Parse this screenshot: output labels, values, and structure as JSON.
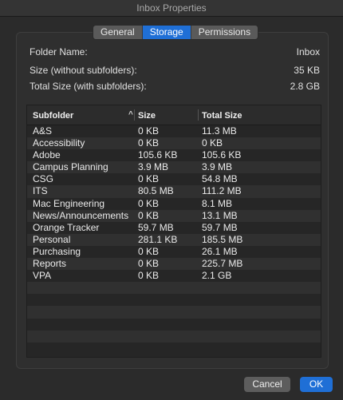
{
  "window": {
    "title": "Inbox Properties"
  },
  "tabs": [
    {
      "label": "General"
    },
    {
      "label": "Storage"
    },
    {
      "label": "Permissions"
    }
  ],
  "info": {
    "folder_name_label": "Folder Name:",
    "folder_name_value": "Inbox",
    "size_label": "Size (without subfolders):",
    "size_value": "35 KB",
    "total_label": "Total Size (with subfolders):",
    "total_value": "2.8 GB"
  },
  "table": {
    "headers": {
      "subfolder": "Subfolder",
      "sort_glyph": "^",
      "size": "Size",
      "total": "Total Size"
    },
    "rows": [
      {
        "name": "A&S",
        "size": "0 KB",
        "total": "11.3 MB"
      },
      {
        "name": "Accessibility",
        "size": "0 KB",
        "total": "0 KB"
      },
      {
        "name": "Adobe",
        "size": "105.6 KB",
        "total": "105.6 KB"
      },
      {
        "name": "Campus Planning",
        "size": "3.9 MB",
        "total": "3.9 MB"
      },
      {
        "name": "CSG",
        "size": "0 KB",
        "total": "54.8 MB"
      },
      {
        "name": "ITS",
        "size": "80.5 MB",
        "total": "111.2 MB"
      },
      {
        "name": "Mac Engineering",
        "size": "0 KB",
        "total": "8.1 MB"
      },
      {
        "name": "News/Announcements",
        "size": "0 KB",
        "total": "13.1 MB"
      },
      {
        "name": "Orange Tracker",
        "size": "59.7 MB",
        "total": "59.7 MB"
      },
      {
        "name": "Personal",
        "size": "281.1 KB",
        "total": "185.5 MB"
      },
      {
        "name": "Purchasing",
        "size": "0 KB",
        "total": "26.1 MB"
      },
      {
        "name": "Reports",
        "size": "0 KB",
        "total": "225.7 MB"
      },
      {
        "name": "VPA",
        "size": "0 KB",
        "total": "2.1 GB"
      }
    ]
  },
  "buttons": {
    "cancel": "Cancel",
    "ok": "OK"
  },
  "colors": {
    "accent": "#1f6fd6",
    "background": "#2b2b2b"
  }
}
